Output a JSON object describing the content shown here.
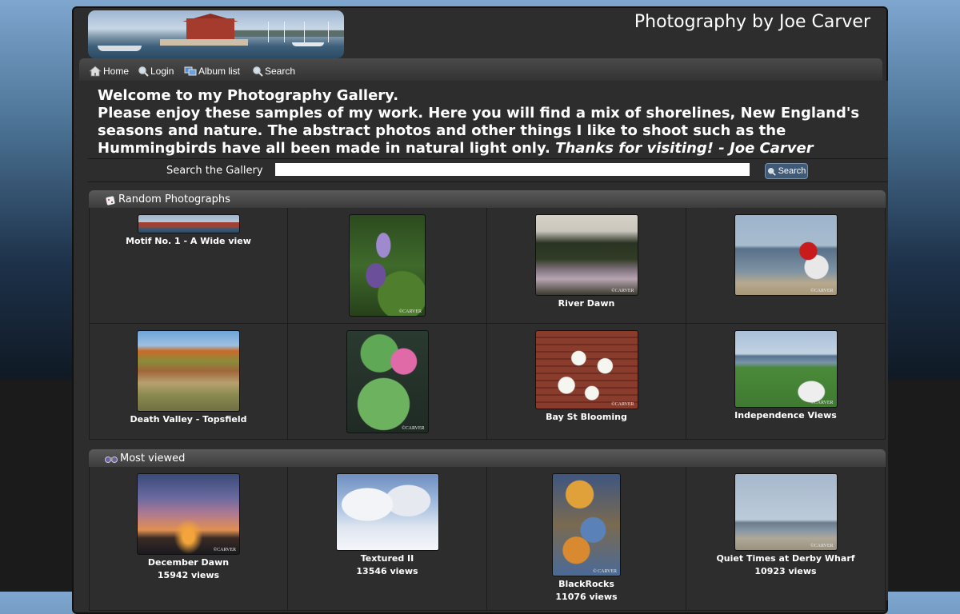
{
  "site": {
    "title": "Photography by Joe Carver"
  },
  "nav": {
    "items": [
      {
        "label": "Home",
        "icon": "home-icon"
      },
      {
        "label": "Login",
        "icon": "magnifier-key-icon"
      },
      {
        "label": "Album list",
        "icon": "album-list-icon"
      },
      {
        "label": "Search",
        "icon": "search-icon"
      }
    ]
  },
  "welcome": {
    "title": "Welcome to my Photography Gallery.",
    "body": "Please enjoy these samples of my work. Here you will find a mix of shorelines, New England's seasons and nature. The abstract photos and other things I like to shoot such as the Hummingbirds have all been made in natural light only.",
    "thanks": "Thanks for visiting! - Joe Carver"
  },
  "search": {
    "label": "Search the Gallery",
    "input_value": "",
    "button_label": "Search"
  },
  "random": {
    "header": "Random Photographs",
    "photos": [
      {
        "caption": "Motif No. 1 - A Wide view",
        "watermark": ""
      },
      {
        "caption": "",
        "watermark": "©CARVER"
      },
      {
        "caption": "River Dawn",
        "watermark": "©CARVER"
      },
      {
        "caption": "",
        "watermark": "©CARVER"
      },
      {
        "caption": "Death Valley - Topsfield",
        "watermark": ""
      },
      {
        "caption": "",
        "watermark": "©CARVER"
      },
      {
        "caption": "Bay St Blooming",
        "watermark": "©CARVER"
      },
      {
        "caption": "Independence Views",
        "watermark": "©CARVER"
      }
    ]
  },
  "most_viewed": {
    "header": "Most viewed",
    "photos": [
      {
        "caption": "December Dawn",
        "views": "15942 views",
        "watermark": "©CARVER"
      },
      {
        "caption": "Textured II",
        "views": "13546 views",
        "watermark": ""
      },
      {
        "caption": "BlackRocks",
        "views": "11076 views",
        "watermark": "© CARVER"
      },
      {
        "caption": "Quiet Times at Derby Wharf",
        "views": "10923 views",
        "watermark": "©CARVER"
      }
    ]
  }
}
